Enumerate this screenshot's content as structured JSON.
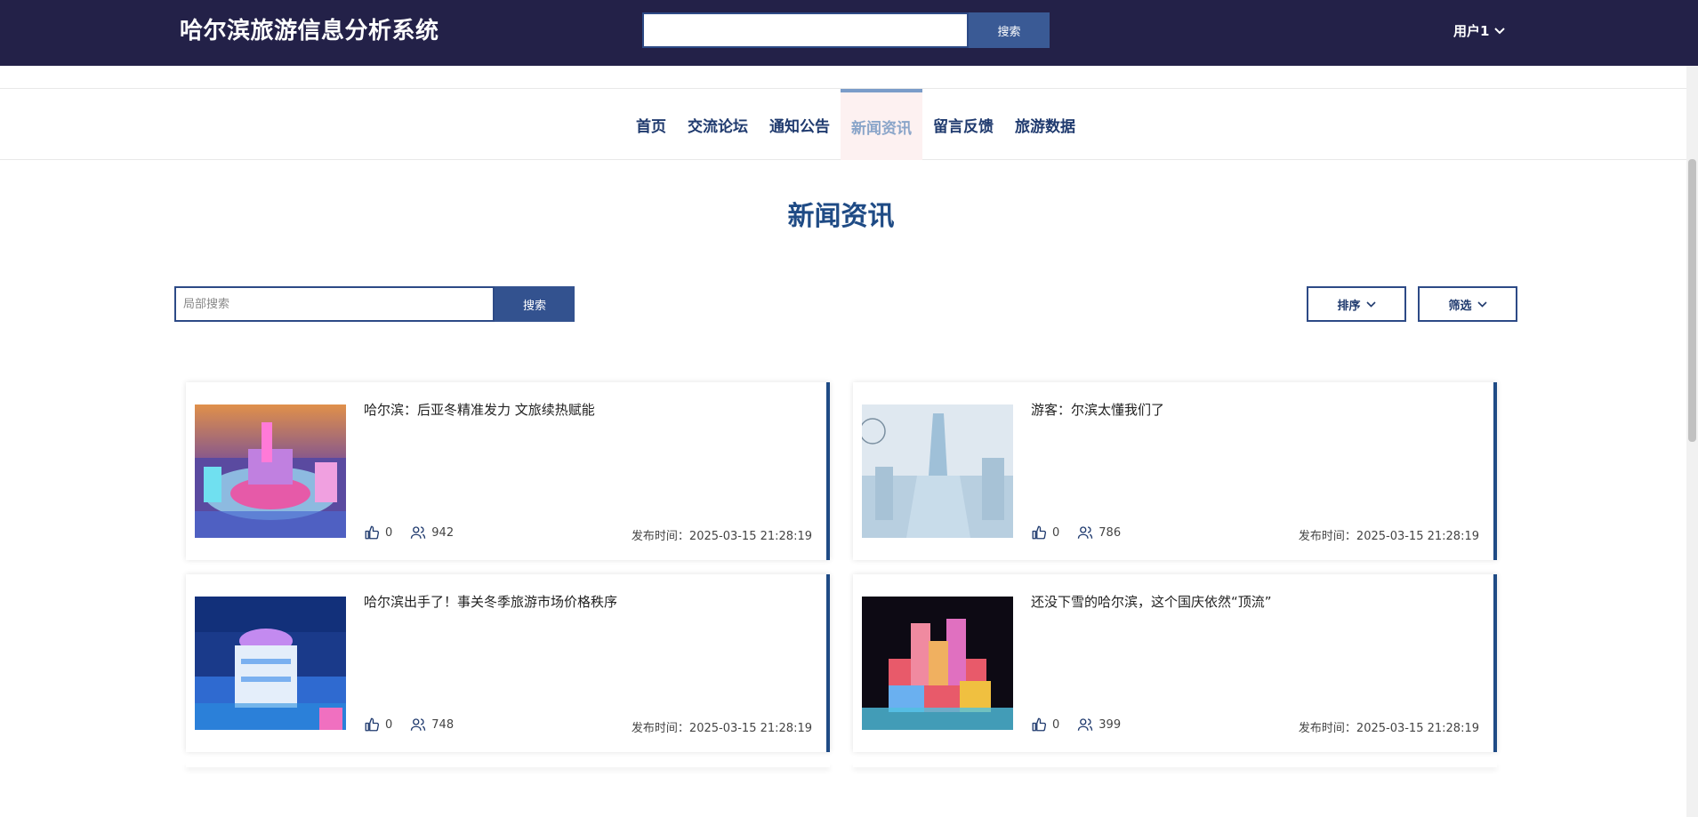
{
  "header": {
    "site_title": "哈尔滨旅游信息分析系统",
    "search_placeholder": "",
    "search_button": "搜索",
    "user_label": "用户1"
  },
  "nav": {
    "items": [
      {
        "label": "首页"
      },
      {
        "label": "交流论坛"
      },
      {
        "label": "通知公告"
      },
      {
        "label": "新闻资讯"
      },
      {
        "label": "留言反馈"
      },
      {
        "label": "旅游数据"
      }
    ],
    "active_index": 3
  },
  "page": {
    "title": "新闻资讯",
    "local_search_placeholder": "局部搜索",
    "local_search_button": "搜索",
    "sort_label": "排序",
    "filter_label": "筛选"
  },
  "news": [
    {
      "title": "哈尔滨：后亚冬精准发力 文旅续热赋能",
      "likes": "0",
      "views": "942",
      "date": "发布时间：2025-03-15 21:28:19"
    },
    {
      "title": "游客：尔滨太懂我们了",
      "likes": "0",
      "views": "786",
      "date": "发布时间：2025-03-15 21:28:19"
    },
    {
      "title": "哈尔滨出手了！事关冬季旅游市场价格秩序",
      "likes": "0",
      "views": "748",
      "date": "发布时间：2025-03-15 21:28:19"
    },
    {
      "title": "还没下雪的哈尔滨，这个国庆依然“顶流”",
      "likes": "0",
      "views": "399",
      "date": "发布时间：2025-03-15 21:28:19"
    }
  ],
  "colors": {
    "header_bg": "#232148",
    "accent": "#1f4b85",
    "nav_active_bg": "#fdf1f1"
  },
  "icons": {
    "like": "thumbs-up-icon",
    "views": "users-icon",
    "dropdown": "chevron-down-icon"
  }
}
